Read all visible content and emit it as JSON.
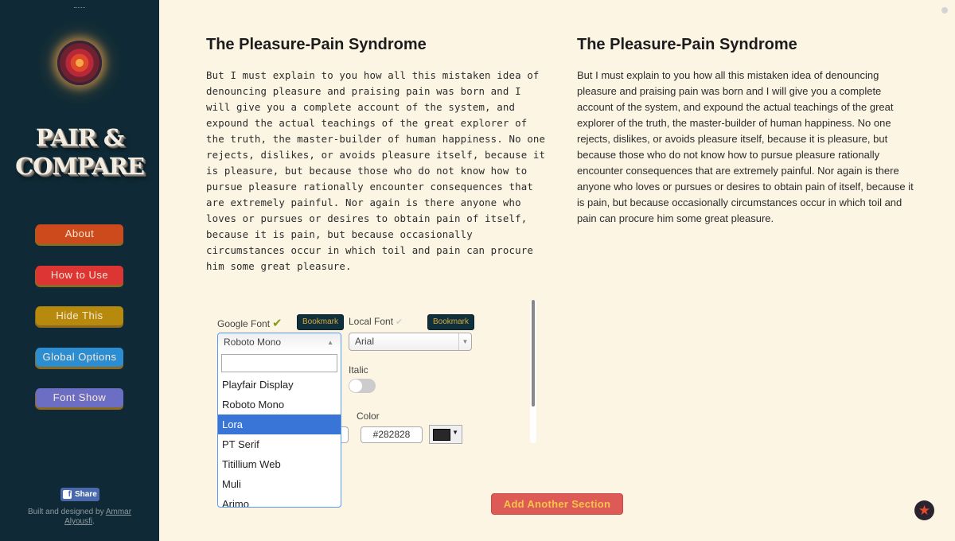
{
  "sidebar": {
    "brand_line1": "PAIR &",
    "brand_line2": "COMPARE",
    "nav": [
      {
        "label": "About",
        "color": "#cd4a1c"
      },
      {
        "label": "How to Use",
        "color": "#dd3434"
      },
      {
        "label": "Hide This",
        "color": "#b78a0e"
      },
      {
        "label": "Global Options",
        "color": "#2b8ed3"
      },
      {
        "label": "Font Show",
        "color": "#6c6ec4"
      }
    ],
    "share_label": "Share",
    "credits_prefix": "Built and designed by ",
    "credits_link": "Ammar Alyousfi",
    "credits_suffix": "."
  },
  "left_section": {
    "title": "The Pleasure-Pain Syndrome",
    "body": "But I must explain to you how all this mistaken idea of denouncing pleasure and praising pain was born and I will give you a complete account of the system, and expound the actual teachings of the great explorer of the truth, the master-builder of human happiness. No one rejects, dislikes, or avoids pleasure itself, because it is pleasure, but because those who do not know how to pursue pleasure rationally encounter consequences that are extremely painful. Nor again is there anyone who loves or pursues or desires to obtain pain of itself, because it is pain, but because occasionally circumstances occur in which toil and pain can procure him some great pleasure."
  },
  "right_section": {
    "title": "The Pleasure-Pain Syndrome",
    "body": "But I must explain to you how all this mistaken idea of denouncing pleasure and praising pain was born and I will give you a complete account of the system, and expound the actual teachings of the great explorer of the truth, the master-builder of human happiness. No one rejects, dislikes, or avoids pleasure itself, because it is pleasure, but because those who do not know how to pursue pleasure rationally encounter consequences that are extremely painful. Nor again is there anyone who loves or pursues or desires to obtain pain of itself, because it is pain, but because occasionally circumstances occur in which toil and pain can procure him some great pleasure."
  },
  "options": {
    "google_font_label": "Google Font",
    "google_check": "✔",
    "local_font_label": "Local Font",
    "local_check": "✔",
    "bookmark_label": "Bookmark",
    "google_font_selected": "Roboto Mono",
    "google_font_search_value": "",
    "google_font_options": [
      "Playfair Display",
      "Roboto Mono",
      "Lora",
      "PT Serif",
      "Titillium Web",
      "Muli",
      "Arimo"
    ],
    "google_font_highlighted": "Lora",
    "local_font_selected": "Arial",
    "italic_label": "Italic",
    "italic_on": false,
    "color_label": "Color",
    "color_value": "#282828"
  },
  "footer": {
    "add_section_label": "Add Another Section"
  }
}
